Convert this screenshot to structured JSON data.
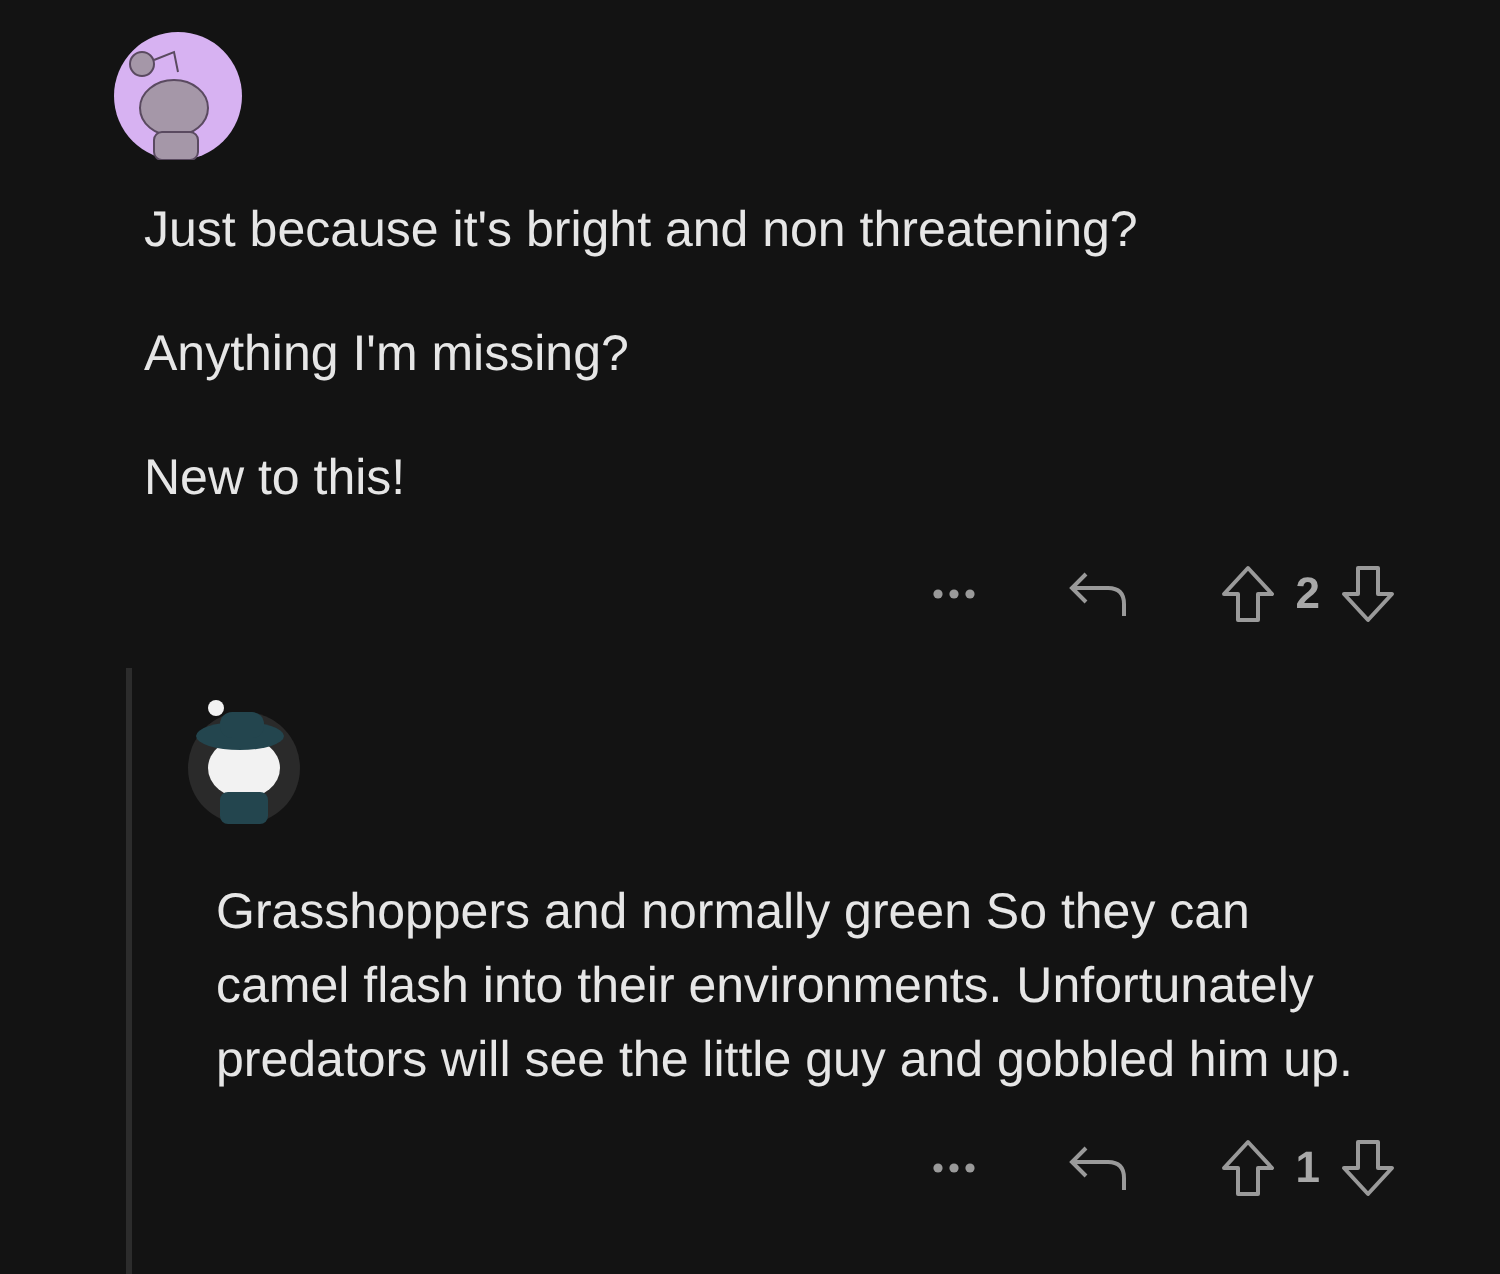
{
  "comment": {
    "paragraphs": [
      "Just because it's bright and non threatening?",
      "Anything I'm missing?",
      "New to this!"
    ],
    "score": "2",
    "replies": [
      {
        "paragraphs": [
          "Grasshoppers and normally green So they can camel flash into their environments. Unfortunately predators will see  the little guy and gobbled him up."
        ],
        "score": "1"
      }
    ]
  }
}
